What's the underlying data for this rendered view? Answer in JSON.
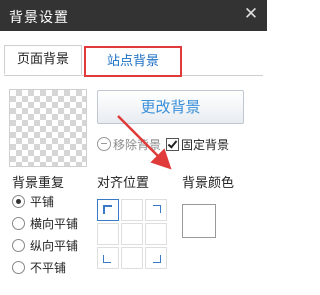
{
  "window": {
    "title": "背景设置",
    "close_icon": "close-icon"
  },
  "tabs": [
    {
      "label": "页面背景",
      "active": false
    },
    {
      "label": "站点背景",
      "active": true
    }
  ],
  "preview": {
    "icon": "transparent-checkerboard"
  },
  "actions": {
    "change_label": "更改背景",
    "remove_label": "移除背景",
    "fixed_label": "固定背景",
    "fixed_checked": true
  },
  "repeat": {
    "label": "背景重复",
    "options": [
      {
        "label": "平铺",
        "checked": true
      },
      {
        "label": "横向平铺",
        "checked": false
      },
      {
        "label": "纵向平铺",
        "checked": false
      },
      {
        "label": "不平铺",
        "checked": false
      }
    ]
  },
  "align": {
    "label": "对齐位置",
    "selected": "top-left"
  },
  "color": {
    "label": "背景颜色",
    "value": "#ffffff"
  },
  "colors": {
    "titlebar": "#333333",
    "accent": "#3a8fd8",
    "highlight": "#e03a3a"
  }
}
